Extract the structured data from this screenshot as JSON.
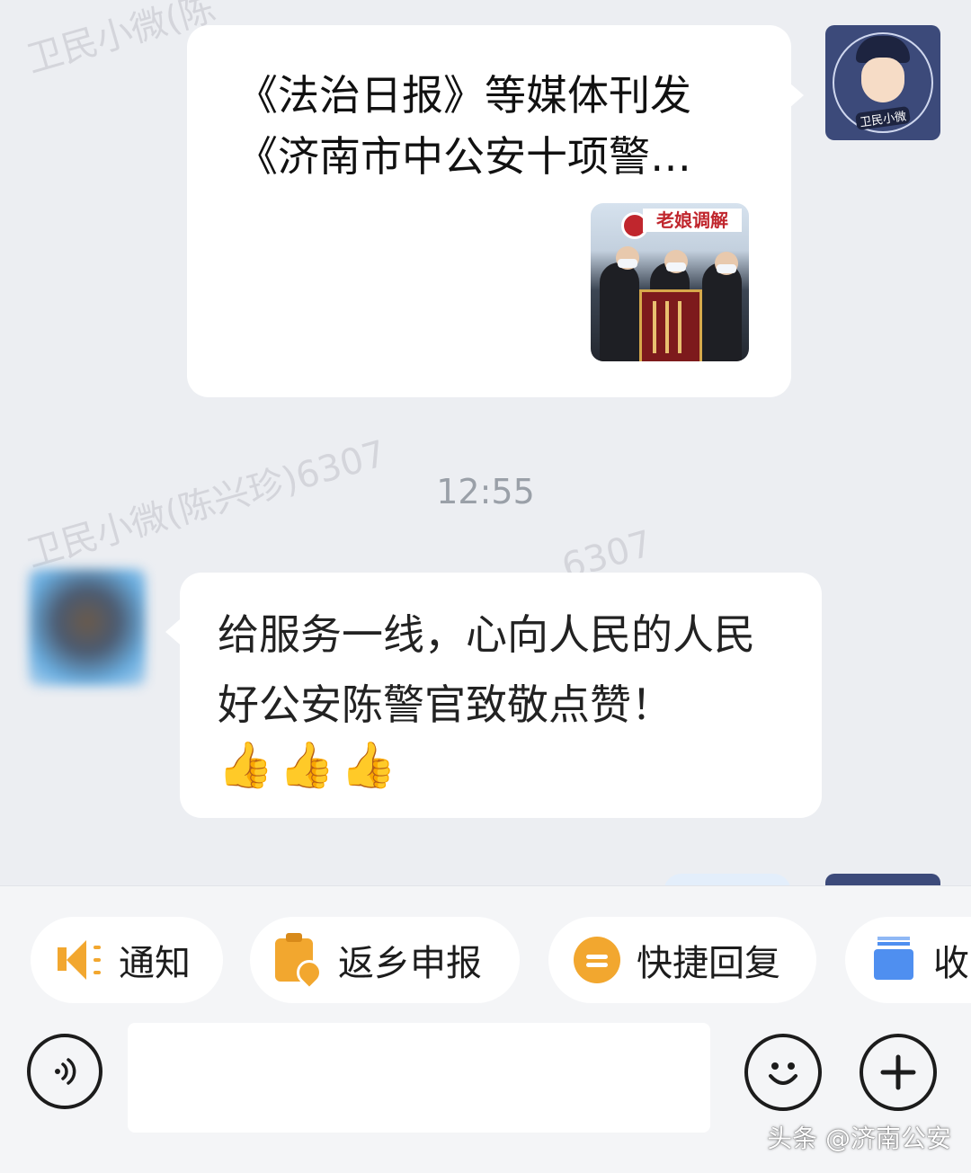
{
  "watermarks": [
    "卫民小微(陈",
    "卫民小微(陈兴珍)6307",
    "6307"
  ],
  "outgoing_card": {
    "title_line1": "《法治日报》等媒体刊发",
    "title_line2": "《济南市中公安十项警…",
    "thumbnail_sign": "老娘调解",
    "avatar_badge": "卫民小微"
  },
  "timestamp": "12:55",
  "incoming_message": {
    "text": "给服务一线，心向人民的人民好公安陈警官致敬点赞！",
    "emoji": "👍👍👍"
  },
  "quick_chips": [
    {
      "label": "通知",
      "icon": "megaphone-icon"
    },
    {
      "label": "返乡申报",
      "icon": "clipboard-location-icon"
    },
    {
      "label": "快捷回复",
      "icon": "chat-bubble-icon"
    },
    {
      "label": "收",
      "icon": "stack-icon"
    }
  ],
  "input": {
    "placeholder": ""
  },
  "footer_watermark": "头条 @济南公安",
  "colors": {
    "accent": "#f2a72f",
    "blue_icon": "#4f8ff0",
    "background": "#eceef2"
  }
}
